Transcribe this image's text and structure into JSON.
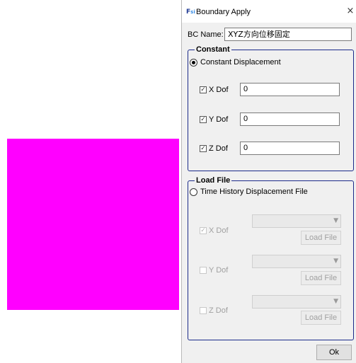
{
  "window": {
    "title": "Boundary Apply",
    "close_glyph": "×",
    "icon": "app-icon"
  },
  "bc_name": {
    "label": "BC Name:",
    "value": "XYZ方向位移固定"
  },
  "constant": {
    "legend": "Constant",
    "radio_label": "Constant Displacement",
    "radio_selected": true,
    "dofs": [
      {
        "label": "X Dof",
        "checked": true,
        "value": "0"
      },
      {
        "label": "Y Dof",
        "checked": true,
        "value": "0"
      },
      {
        "label": "Z Dof",
        "checked": true,
        "value": "0"
      }
    ]
  },
  "load_file": {
    "legend": "Load File",
    "radio_label": "Time History Displacement File",
    "radio_selected": false,
    "dofs": [
      {
        "label": "X Dof",
        "checked": true,
        "button": "Load File"
      },
      {
        "label": "Y Dof",
        "checked": false,
        "button": "Load File"
      },
      {
        "label": "Z Dof",
        "checked": false,
        "button": "Load File"
      }
    ]
  },
  "ok_label": "Ok",
  "colors": {
    "viewport_shape": "#ff00ff",
    "group_border": "#1b2a8a"
  }
}
